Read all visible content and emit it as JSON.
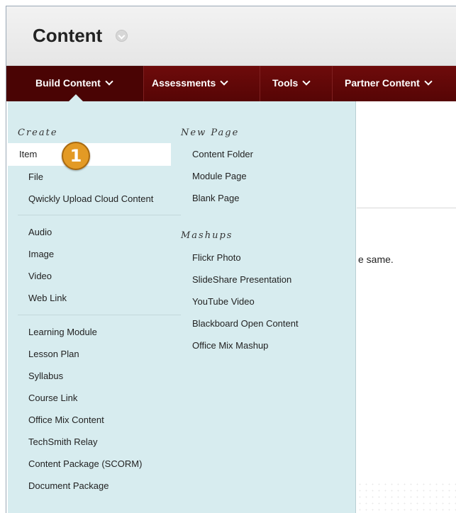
{
  "header": {
    "title": "Content"
  },
  "nav": {
    "items": [
      {
        "label": "Build Content"
      },
      {
        "label": "Assessments"
      },
      {
        "label": "Tools"
      },
      {
        "label": "Partner Content"
      }
    ]
  },
  "background_text": "e same.",
  "menu": {
    "create": {
      "title": "Create",
      "group1": [
        "Item",
        "File",
        "Qwickly Upload Cloud Content"
      ],
      "group2": [
        "Audio",
        "Image",
        "Video",
        "Web Link"
      ],
      "group3": [
        "Learning Module",
        "Lesson Plan",
        "Syllabus",
        "Course Link",
        "Office Mix Content",
        "TechSmith Relay",
        "Content Package (SCORM)",
        "Document Package"
      ]
    },
    "new_page": {
      "title": "New Page",
      "items": [
        "Content Folder",
        "Module Page",
        "Blank Page"
      ]
    },
    "mashups": {
      "title": "Mashups",
      "items": [
        "Flickr Photo",
        "SlideShare Presentation",
        "YouTube Video",
        "Blackboard Open Content",
        "Office Mix Mashup"
      ]
    }
  },
  "callout": {
    "number": "1",
    "color": "#e39a25"
  },
  "colors": {
    "nav_bg": "#5e0707",
    "menu_bg": "#d7ecef"
  }
}
